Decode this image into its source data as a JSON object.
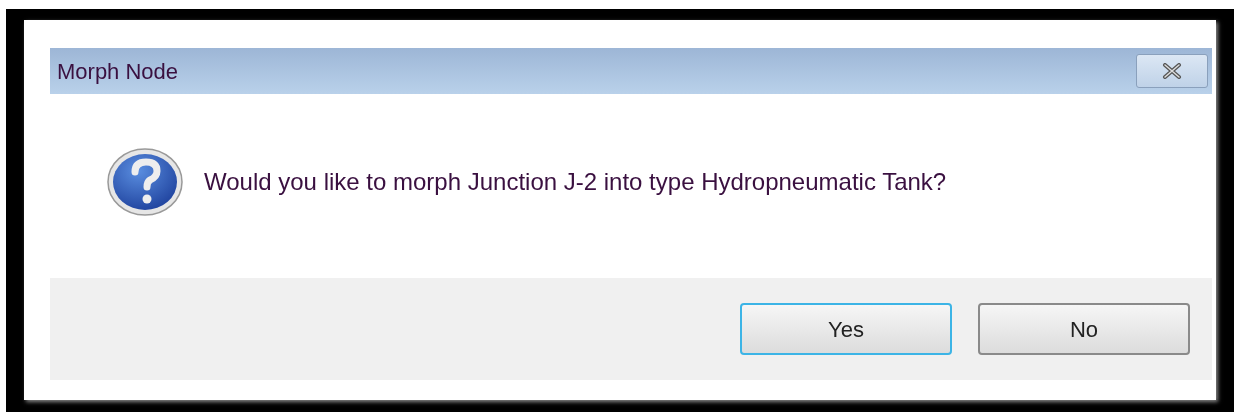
{
  "window": {
    "title": "Morph Node"
  },
  "message": "Would you like to morph Junction J-2 into type Hydropneumatic Tank?",
  "buttons": [
    {
      "label": "Yes",
      "focused": true
    },
    {
      "label": "No",
      "focused": false
    }
  ]
}
